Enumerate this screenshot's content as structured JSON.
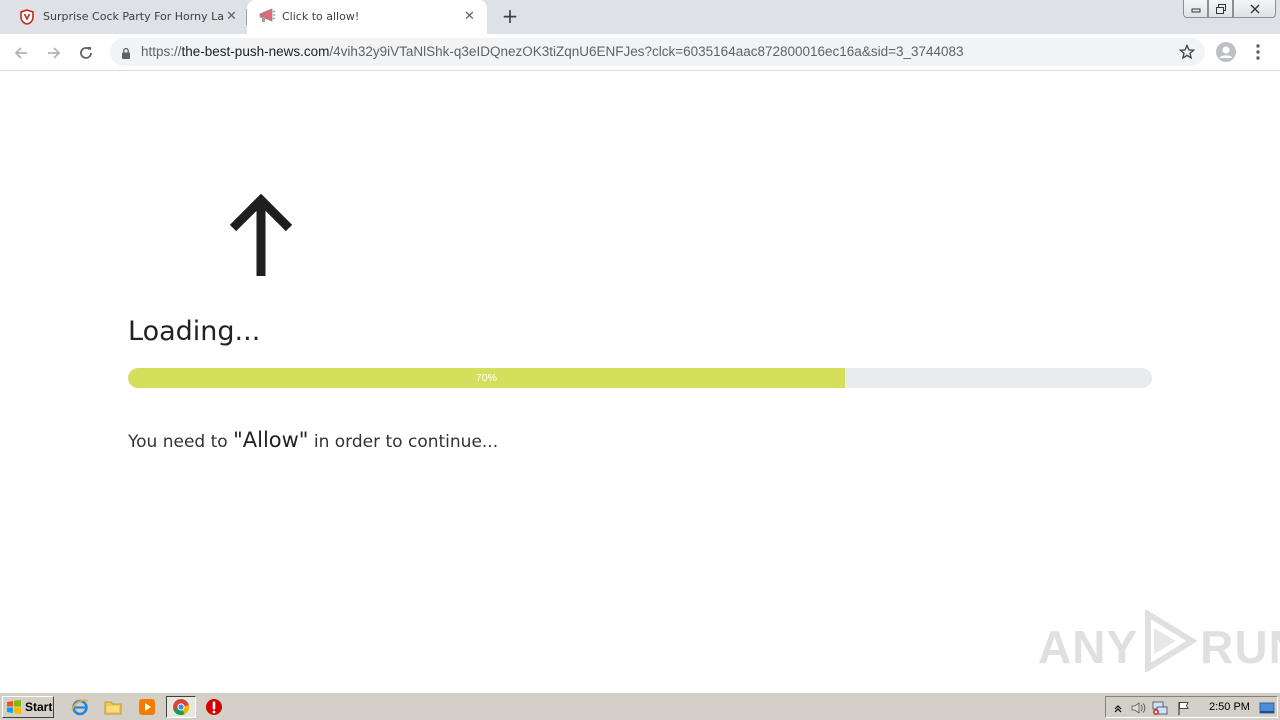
{
  "browser": {
    "tabs": [
      {
        "title": "Surprise Cock Party For Horny Ladies",
        "active": false,
        "favicon": "shield-icon"
      },
      {
        "title": "Click to allow!",
        "active": true,
        "favicon": "megaphone-icon"
      }
    ],
    "new_tab_symbol": "+",
    "close_symbol": "✕",
    "url": {
      "scheme": "https://",
      "host": "the-best-push-news.com",
      "path": "/4vih32y9iVTaNlShk-q3eIDQnezOK3tiZqnU6ENFJes?clck=6035164aac872800016ec16a&sid=3_3744083"
    }
  },
  "page": {
    "heading": "Loading...",
    "progress": {
      "percent": 70,
      "label": "70%",
      "fill_color": "#d4e05b"
    },
    "message_before": "You need to ",
    "message_allow": "\"Allow\"",
    "message_after": " in order to continue..."
  },
  "watermark": {
    "left": "ANY",
    "right": "RUN"
  },
  "taskbar": {
    "start_label": "Start",
    "apps": [
      "ie-icon",
      "explorer-icon",
      "media-player-icon",
      "chrome-icon",
      "stop-icon"
    ],
    "clock": "2:50 PM"
  }
}
